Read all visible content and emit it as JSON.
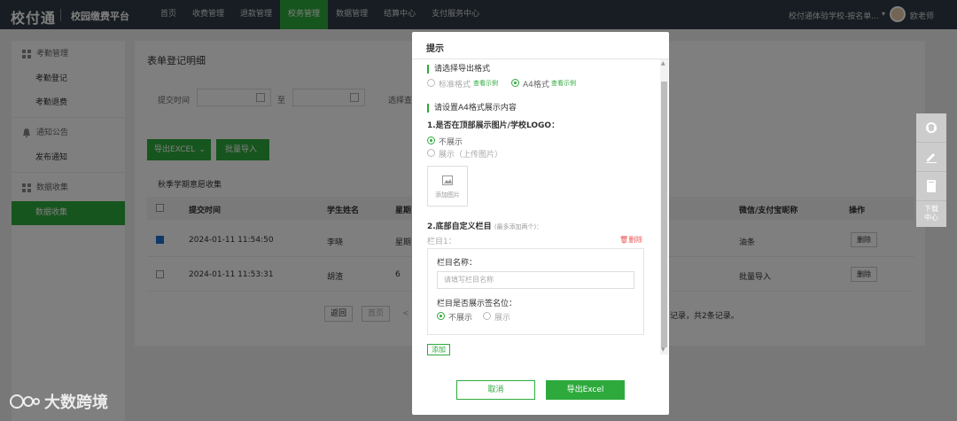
{
  "topbar": {
    "logo": "校付通",
    "platform": "校园缴费平台",
    "nav": [
      "首页",
      "收费管理",
      "退款管理",
      "校务管理",
      "数据管理",
      "结算中心",
      "支付服务中心"
    ],
    "active_nav_index": 3,
    "school": "校付通体验学校-按名单...",
    "teacher": "欧老师"
  },
  "sidebar": {
    "groups": [
      {
        "label": "考勤管理",
        "items": [
          "考勤登记",
          "考勤退费"
        ]
      },
      {
        "label": "通知公告",
        "items": [
          "发布通知"
        ]
      },
      {
        "label": "数据收集",
        "items": [
          "数据收集"
        ]
      }
    ]
  },
  "main": {
    "title": "表单登记明细",
    "filter_submit_time": "提交时间",
    "filter_to": "至",
    "filter_select": "选择查",
    "export_excel": "导出EXCEL",
    "batch_import": "批量导入",
    "table_title": "秋季学期意愿收集",
    "columns": [
      "提交时间",
      "学生姓名",
      "星期",
      "微信/支付宝昵称",
      "操作"
    ],
    "rows": [
      {
        "time": "2024-01-11 11:54:50",
        "name": "李晓",
        "day": "星期",
        "nick": "油条",
        "op": "删除",
        "checked": true
      },
      {
        "time": "2024-01-11 11:53:31",
        "name": "胡渣",
        "day": "6",
        "nick": "批量导入",
        "op": "删除",
        "checked": false
      }
    ],
    "pager_back": "返回",
    "pager_first": "首页",
    "pager_prev": "<",
    "pager_info": "记录，共2条记录。"
  },
  "float_bar": {
    "download": [
      "下载",
      "中心"
    ]
  },
  "modal": {
    "title": "提示",
    "export_format_label": "请选择导出格式",
    "format_standard": "标准格式",
    "format_a4": "A4格式",
    "view_example": "查看示例",
    "a4_settings_label": "请设置A4格式展示内容",
    "q1": "1.是否在顶部展示图片/学校LOGO：",
    "opt_hide": "不展示",
    "opt_show_upload": "展示（上传图片）",
    "add_image": "添加图片",
    "q2": "2.底部自定义栏目",
    "q2_hint": "(最多添加两个)：",
    "column1": "栏目1：",
    "delete": "删除",
    "column_name_label": "栏目名称：",
    "column_name_placeholder": "请填写栏目名称",
    "show_sign_label": "栏目是否展示签名位：",
    "sign_hide": "不展示",
    "sign_show": "展示",
    "add": "添加",
    "cancel": "取消",
    "export": "导出Excel"
  },
  "watermark": "大数跨境"
}
